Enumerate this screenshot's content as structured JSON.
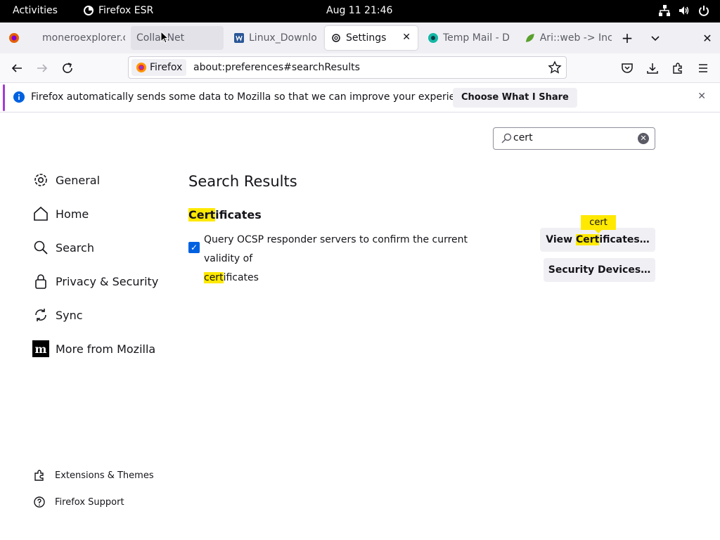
{
  "topbar": {
    "activities": "Activities",
    "app_name": "Firefox ESR",
    "clock": "Aug 11  21:46"
  },
  "tabs": [
    {
      "label": "moneroexplorer.c",
      "icon": "monero-icon",
      "active": false
    },
    {
      "label": "CollabNet",
      "icon": "",
      "active": false
    },
    {
      "label": "Linux_Downlo",
      "icon": "word-doc-icon",
      "active": false
    },
    {
      "label": "Settings",
      "icon": "gear-icon",
      "active": true
    },
    {
      "label": "Temp Mail - D",
      "icon": "tempmail-icon",
      "active": false
    },
    {
      "label": "Ari::web -> Inc",
      "icon": "leaf-icon",
      "active": false
    }
  ],
  "urlbar": {
    "identity": "Firefox",
    "url": "about:preferences#searchResults"
  },
  "notice": {
    "text": "Firefox automatically sends some data to Mozilla so that we can improve your experience.",
    "button": "Choose What I Share"
  },
  "search": {
    "value": "cert"
  },
  "sidebar": {
    "items": [
      {
        "label": "General",
        "icon": "gear-icon"
      },
      {
        "label": "Home",
        "icon": "home-icon"
      },
      {
        "label": "Search",
        "icon": "search-icon"
      },
      {
        "label": "Privacy & Security",
        "icon": "lock-icon"
      },
      {
        "label": "Sync",
        "icon": "sync-icon"
      },
      {
        "label": "More from Mozilla",
        "icon": "mozilla-icon"
      }
    ],
    "footer": [
      {
        "label": "Extensions & Themes",
        "icon": "puzzle-icon"
      },
      {
        "label": "Firefox Support",
        "icon": "help-icon"
      }
    ]
  },
  "main": {
    "title": "Search Results",
    "certificates": {
      "heading_hl": "Cert",
      "heading_rest": "ificates",
      "ocsp_line1": "Query OCSP responder servers to confirm the current validity of",
      "ocsp_hl": "cert",
      "ocsp_rest": "ificates",
      "ocsp_checked": true,
      "view_pre": "View ",
      "view_hl": "Cert",
      "view_post": "ificates…",
      "devices": "Security Devices…",
      "tooltip": "cert"
    }
  },
  "colors": {
    "accent": "#0061e0",
    "highlight": "#ffe900",
    "notice_bar": "#a33bd6"
  }
}
